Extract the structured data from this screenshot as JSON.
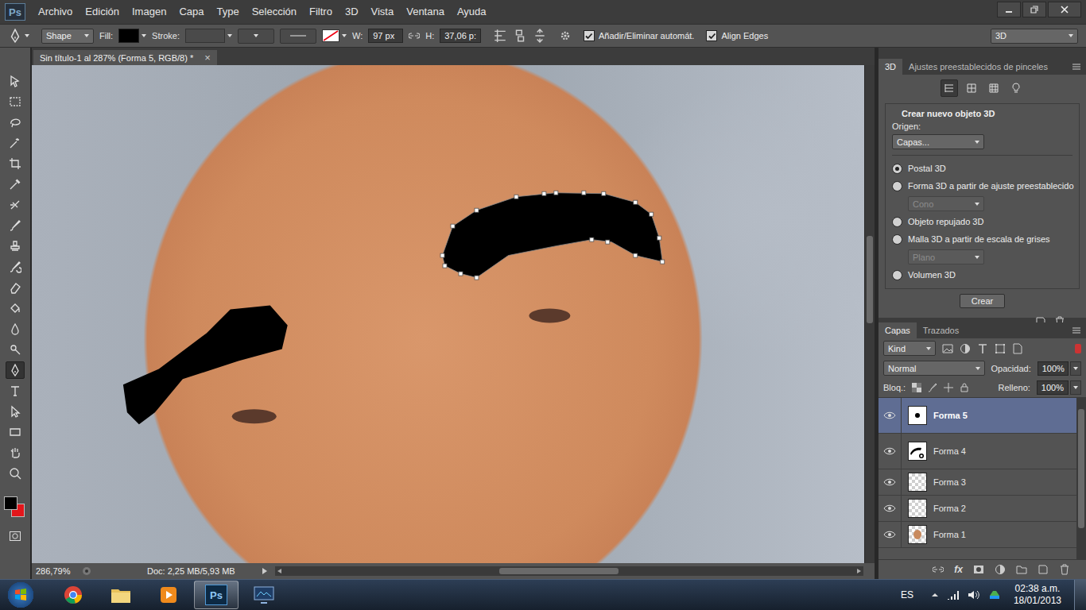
{
  "menu_bar": {
    "logo": "Ps",
    "items": [
      "Archivo",
      "Edición",
      "Imagen",
      "Capa",
      "Type",
      "Selección",
      "Filtro",
      "3D",
      "Vista",
      "Ventana",
      "Ayuda"
    ]
  },
  "options_bar": {
    "mode": "Shape",
    "fill": {
      "label": "Fill:",
      "color": "#000000"
    },
    "stroke": {
      "label": "Stroke:"
    },
    "width": {
      "label": "W:",
      "value": "97 px"
    },
    "height": {
      "label": "H:",
      "value": "37,06 p:"
    },
    "checkboxes": [
      {
        "label": "Añadir/Eliminar automát.",
        "checked": true
      },
      {
        "label": "Align Edges",
        "checked": true
      }
    ],
    "workspace": "3D"
  },
  "tools": [
    {
      "selected": false
    },
    {
      "selected": false
    },
    {
      "selected": false
    },
    {
      "selected": false
    },
    {
      "selected": false
    },
    {
      "selected": false
    },
    {
      "selected": false
    },
    {
      "selected": false
    },
    {
      "selected": false
    },
    {
      "selected": false
    },
    {
      "selected": false
    },
    {
      "selected": false
    },
    {
      "selected": false
    },
    {
      "selected": false
    },
    {
      "selected": true
    },
    {
      "selected": false
    },
    {
      "selected": false
    },
    {
      "selected": false
    },
    {
      "selected": false
    },
    {
      "selected": false
    }
  ],
  "colors": [
    {
      "role": "foreground",
      "color": "#000000"
    },
    {
      "role": "background",
      "color": "#e3161b"
    }
  ],
  "document": {
    "tab": "Sin título-1 al 287% (Forma 5, RGB/8) *",
    "close": "×"
  },
  "status_bar": {
    "zoom": "286,79%",
    "info": "Doc: 2,25 MB/5,93 MB"
  },
  "panel_3d": {
    "tabs": [
      {
        "label": "3D",
        "selected": true
      },
      {
        "label": "Ajustes preestablecidos de pinceles",
        "selected": false
      }
    ],
    "modes": [
      {
        "selected": true
      },
      {
        "selected": false
      },
      {
        "selected": false
      },
      {
        "selected": false
      }
    ],
    "heading": "Crear nuevo objeto 3D",
    "origin_label": "Origen:",
    "origin_value": "Capas...",
    "options": [
      {
        "label": "Postal 3D",
        "selected": true
      },
      {
        "label": "Forma 3D a partir de ajuste preestablecido",
        "selected": false,
        "preset": {
          "value": "Cono",
          "disabled": true
        }
      },
      {
        "label": "Objeto repujado 3D",
        "selected": false
      },
      {
        "label": "Malla 3D a partir de escala de grises",
        "selected": false,
        "preset": {
          "value": "Plano",
          "disabled": true
        }
      },
      {
        "label": "Volumen 3D",
        "selected": false
      }
    ],
    "create_button": "Crear"
  },
  "layers_panel": {
    "tabs": [
      {
        "label": "Capas",
        "selected": true
      },
      {
        "label": "Trazados",
        "selected": false
      }
    ],
    "filter": "Kind",
    "blend_mode": "Normal",
    "opacity_label": "Opacidad:",
    "opacity": "100%",
    "lock_label": "Bloq.:",
    "fill_label": "Relleno:",
    "fill": "100%",
    "layers": [
      {
        "name": "Forma 5",
        "visible": true,
        "selected": true,
        "kind": "dot"
      },
      {
        "name": "Forma 4",
        "visible": true,
        "selected": false,
        "kind": "brow"
      },
      {
        "name": "Forma 3",
        "visible": true,
        "selected": false,
        "kind": "empty"
      },
      {
        "name": "Forma 2",
        "visible": true,
        "selected": false,
        "kind": "empty"
      },
      {
        "name": "Forma 1",
        "visible": true,
        "selected": false,
        "kind": "skin"
      }
    ],
    "fx": "fx"
  },
  "taskbar": {
    "apps": [
      {
        "kind": "browser",
        "selected": false
      },
      {
        "kind": "folder",
        "selected": false
      },
      {
        "kind": "media",
        "selected": false
      },
      {
        "kind": "photoshop",
        "selected": true,
        "icon_text": "Ps"
      },
      {
        "kind": "monitor",
        "selected": false
      }
    ],
    "language": "ES",
    "time": "02:38 a.m.",
    "date": "18/01/2013"
  }
}
